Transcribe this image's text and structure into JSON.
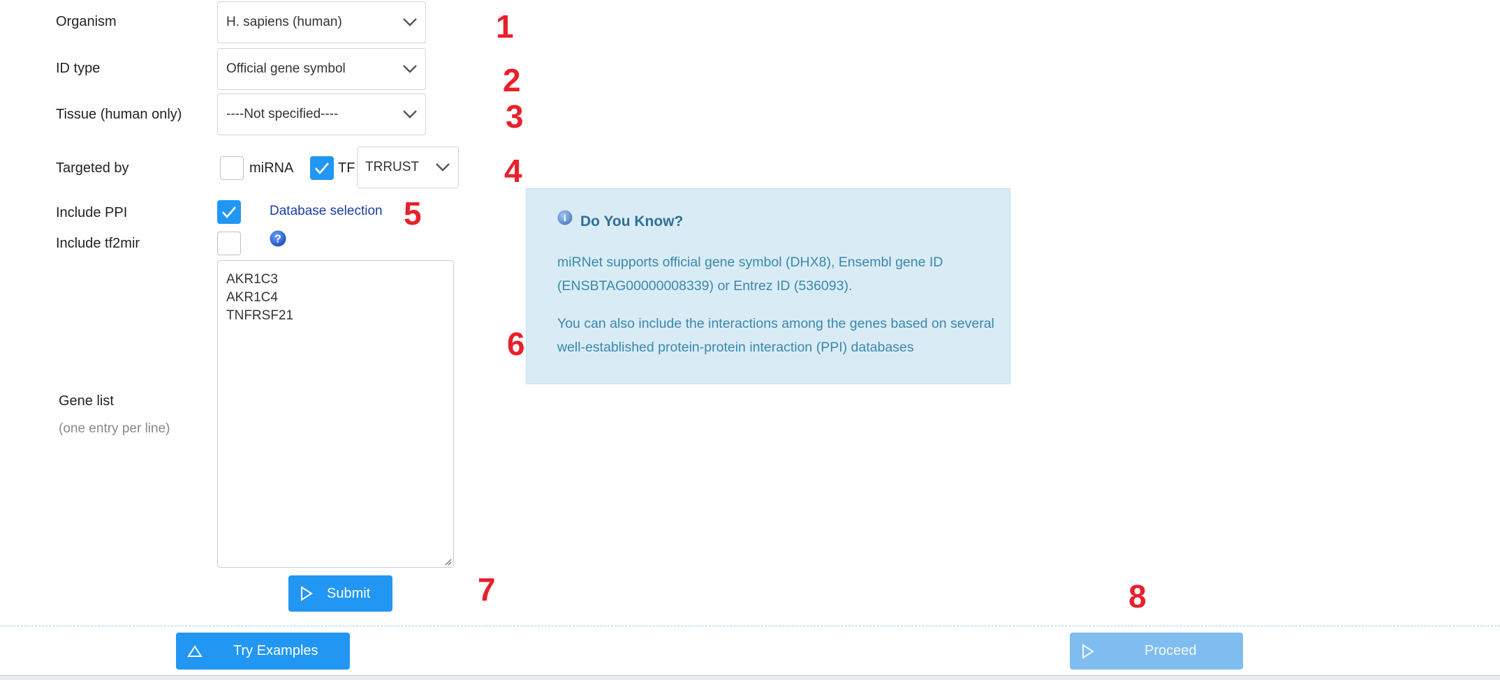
{
  "form": {
    "organism": {
      "label": "Organism",
      "value": "H. sapiens (human)"
    },
    "id_type": {
      "label": "ID type",
      "value": "Official gene symbol"
    },
    "tissue": {
      "label": "Tissue (human only)",
      "value": "----Not specified----"
    },
    "targeted_by": {
      "label": "Targeted by",
      "mirna_label": "miRNA",
      "mirna_checked": false,
      "tf_label": "TF",
      "tf_checked": true,
      "tf_db_value": "TRRUST"
    },
    "ppi": {
      "label": "Include PPI",
      "checked": true,
      "db_link": "Database selection"
    },
    "tf2mir": {
      "label": "Include tf2mir",
      "checked": false
    },
    "gene_list": {
      "label": "Gene list",
      "hint": "(one entry per line)",
      "lines": [
        "AKR1C3",
        "AKR1C4",
        "TNFRSF21"
      ]
    },
    "submit_label": "Submit"
  },
  "info": {
    "title": "Do You Know?",
    "para1": "miRNet supports official gene symbol (DHX8), Ensembl gene ID (ENSBTAG00000008339) or Entrez ID (536093).",
    "para2": "You can also include the interactions among the genes based on several well-established protein-protein interaction (PPI) databases"
  },
  "footer": {
    "examples_label": "Try Examples",
    "proceed_label": "Proceed"
  },
  "markers": [
    "1",
    "2",
    "3",
    "4",
    "5",
    "6",
    "7",
    "8"
  ],
  "colors": {
    "accent": "#2196f3",
    "marker": "#e8202a",
    "info_bg": "#d9ecf5",
    "info_text": "#3a87ad",
    "proceed_disabled": "#7fbdf0"
  }
}
